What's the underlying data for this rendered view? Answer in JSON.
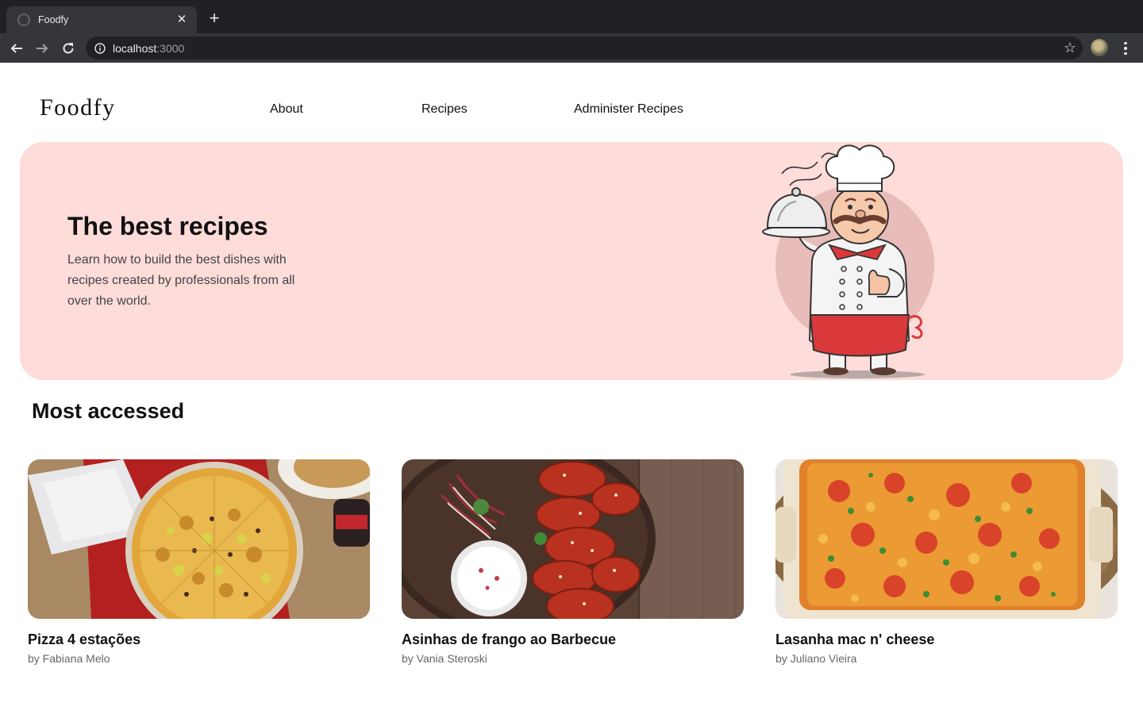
{
  "browser": {
    "tab_title": "Foodfy",
    "url_host": "localhost",
    "url_port": ":3000"
  },
  "header": {
    "logo": "Foodfy",
    "nav": [
      "About",
      "Recipes",
      "Administer Recipes"
    ]
  },
  "hero": {
    "title": "The best recipes",
    "text": "Learn how to build the best dishes with recipes created by professionals from all over the world.",
    "background_color": "#fddcd9"
  },
  "most_accessed": {
    "title": "Most accessed",
    "recipes": [
      {
        "title": "Pizza 4 estações",
        "author": "by Fabiana Melo",
        "image": "pizza"
      },
      {
        "title": "Asinhas de frango ao Barbecue",
        "author": "by Vania Steroski",
        "image": "chicken-wings"
      },
      {
        "title": "Lasanha mac n' cheese",
        "author": "by Juliano Vieira",
        "image": "mac-and-cheese-lasagna"
      }
    ]
  }
}
